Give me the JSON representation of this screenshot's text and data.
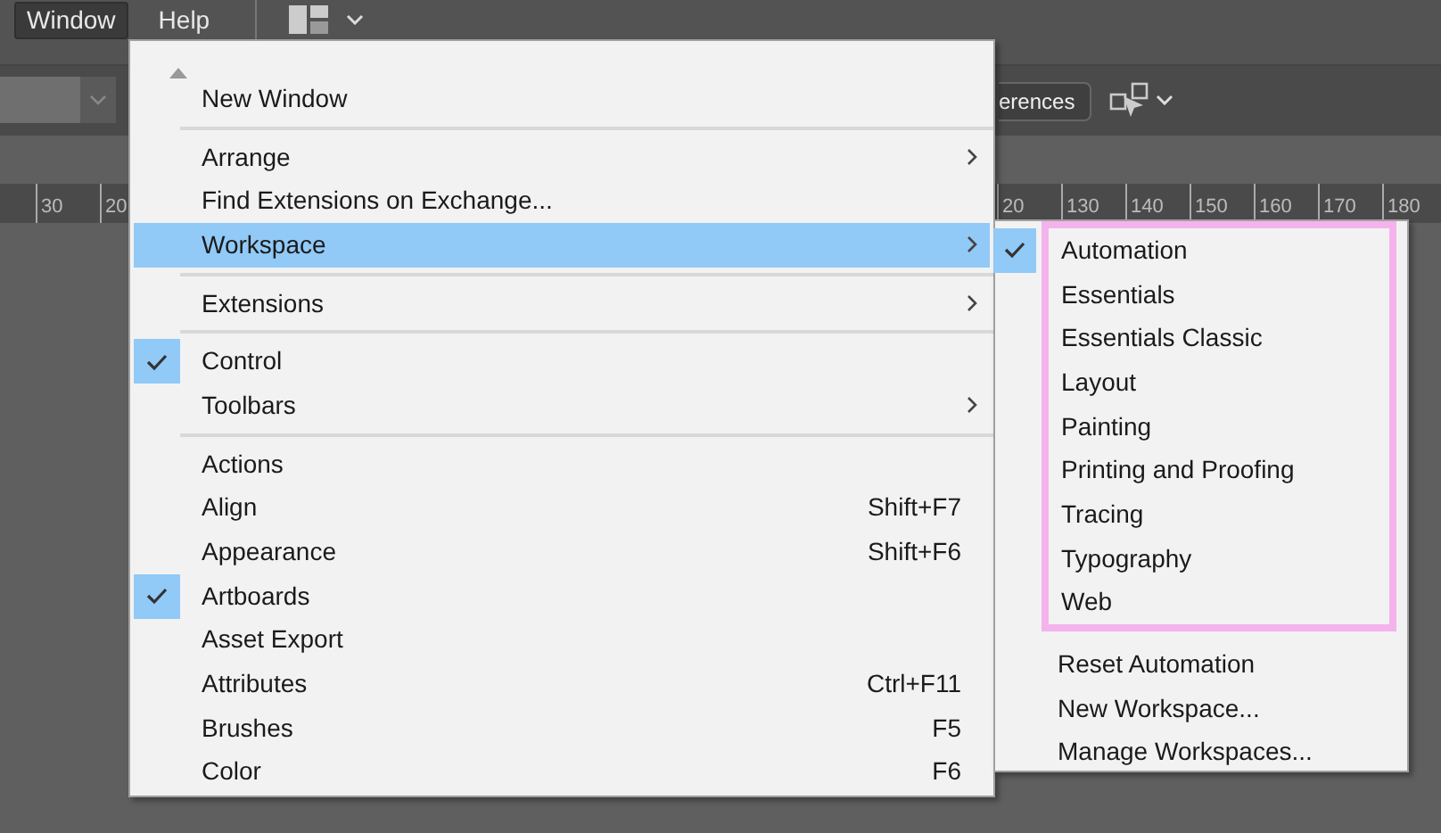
{
  "menubar": [
    {
      "label": "Window",
      "selected": true
    },
    {
      "label": "Help",
      "selected": false
    }
  ],
  "toolbar": {
    "button": "erences"
  },
  "ruler": {
    "left_labels": [
      "30",
      "20"
    ],
    "right_labels": [
      "20",
      "130",
      "140",
      "150",
      "160",
      "170",
      "180"
    ]
  },
  "menu": {
    "sections": [
      {
        "items": [
          {
            "label": "New Window",
            "submenu": false,
            "checked": false,
            "selected": false
          }
        ]
      },
      {
        "items": [
          {
            "label": "Arrange",
            "submenu": true,
            "checked": false,
            "selected": false
          },
          {
            "label": "Find Extensions on Exchange...",
            "submenu": false,
            "checked": false,
            "selected": false
          },
          {
            "label": "Workspace",
            "submenu": true,
            "checked": false,
            "selected": true
          }
        ]
      },
      {
        "items": [
          {
            "label": "Extensions",
            "submenu": true,
            "checked": false,
            "selected": false
          }
        ]
      },
      {
        "items": [
          {
            "label": "Control",
            "submenu": false,
            "checked": true,
            "selected": false
          },
          {
            "label": "Toolbars",
            "submenu": true,
            "checked": false,
            "selected": false
          }
        ]
      },
      {
        "items": [
          {
            "label": "Actions",
            "submenu": false,
            "checked": false,
            "selected": false
          },
          {
            "label": "Align",
            "shortcut": "Shift+F7",
            "submenu": false,
            "checked": false,
            "selected": false
          },
          {
            "label": "Appearance",
            "shortcut": "Shift+F6",
            "submenu": false,
            "checked": false,
            "selected": false
          },
          {
            "label": "Artboards",
            "submenu": false,
            "checked": true,
            "selected": false
          },
          {
            "label": "Asset Export",
            "submenu": false,
            "checked": false,
            "selected": false
          },
          {
            "label": "Attributes",
            "shortcut": "Ctrl+F11",
            "submenu": false,
            "checked": false,
            "selected": false
          },
          {
            "label": "Brushes",
            "shortcut": "F5",
            "submenu": false,
            "checked": false,
            "selected": false
          },
          {
            "label": "Color",
            "shortcut": "F6",
            "submenu": false,
            "checked": false,
            "selected": false
          }
        ]
      }
    ]
  },
  "submenu": {
    "sections": [
      {
        "outlined": true,
        "items": [
          {
            "label": "Automation",
            "checked": true
          },
          {
            "label": "Essentials",
            "checked": false
          },
          {
            "label": "Essentials Classic",
            "checked": false
          },
          {
            "label": "Layout",
            "checked": false
          },
          {
            "label": "Painting",
            "checked": false
          },
          {
            "label": "Printing and Proofing",
            "checked": false
          },
          {
            "label": "Tracing",
            "checked": false
          },
          {
            "label": "Typography",
            "checked": false
          },
          {
            "label": "Web",
            "checked": false
          }
        ]
      },
      {
        "outlined": false,
        "items": [
          {
            "label": "Reset Automation",
            "checked": false
          },
          {
            "label": "New Workspace...",
            "checked": false
          },
          {
            "label": "Manage Workspaces...",
            "checked": false
          }
        ]
      }
    ]
  }
}
